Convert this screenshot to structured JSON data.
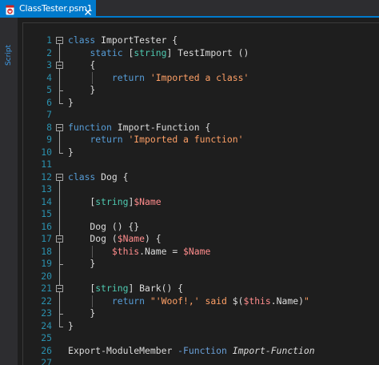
{
  "tab": {
    "title": "ClassTester.psm1",
    "icon": "powershell-file-icon",
    "close_icon": "close-icon"
  },
  "side": {
    "label": "Script"
  },
  "colors": {
    "accent": "#007acc",
    "keyword": "#569cd6",
    "type": "#4ec9b0",
    "variable": "#ff8c8c",
    "string": "#ffa066",
    "line_number": "#2b91af",
    "plain": "#dcdcdc"
  },
  "code": {
    "lines": [
      {
        "n": "1",
        "fold": "open",
        "tokens": [
          [
            "kw",
            "class"
          ],
          [
            "pr",
            " ImportTester {"
          ]
        ]
      },
      {
        "n": "2",
        "fold": "line",
        "tokens": [
          [
            "pr",
            "    "
          ],
          [
            "kw",
            "static"
          ],
          [
            "pr",
            " ["
          ],
          [
            "ty",
            "string"
          ],
          [
            "pr",
            "] TestImport ()"
          ]
        ]
      },
      {
        "n": "3",
        "fold": "open2",
        "tokens": [
          [
            "pr",
            "    {"
          ]
        ]
      },
      {
        "n": "4",
        "fold": "line",
        "tokens": [
          [
            "pr",
            "        "
          ],
          [
            "kw",
            "return"
          ],
          [
            "pr",
            " "
          ],
          [
            "st",
            "'Imported a class'"
          ]
        ]
      },
      {
        "n": "5",
        "fold": "end",
        "tokens": [
          [
            "pr",
            "    }"
          ]
        ]
      },
      {
        "n": "6",
        "fold": "end",
        "tokens": [
          [
            "pr",
            "}"
          ]
        ]
      },
      {
        "n": "7",
        "fold": "",
        "tokens": []
      },
      {
        "n": "8",
        "fold": "open",
        "tokens": [
          [
            "kw",
            "function"
          ],
          [
            "pr",
            " Import-Function {"
          ]
        ]
      },
      {
        "n": "9",
        "fold": "line",
        "tokens": [
          [
            "pr",
            "    "
          ],
          [
            "kw",
            "return"
          ],
          [
            "pr",
            " "
          ],
          [
            "st",
            "'Imported a function'"
          ]
        ]
      },
      {
        "n": "10",
        "fold": "end",
        "tokens": [
          [
            "pr",
            "}"
          ]
        ]
      },
      {
        "n": "11",
        "fold": "",
        "tokens": []
      },
      {
        "n": "12",
        "fold": "open",
        "tokens": [
          [
            "kw",
            "class"
          ],
          [
            "pr",
            " Dog {"
          ]
        ]
      },
      {
        "n": "13",
        "fold": "line",
        "tokens": []
      },
      {
        "n": "14",
        "fold": "line",
        "tokens": [
          [
            "pr",
            "    ["
          ],
          [
            "ty",
            "string"
          ],
          [
            "pr",
            "]"
          ],
          [
            "vr",
            "$Name"
          ]
        ]
      },
      {
        "n": "15",
        "fold": "line",
        "tokens": []
      },
      {
        "n": "16",
        "fold": "line",
        "tokens": [
          [
            "pr",
            "    Dog () {}"
          ]
        ]
      },
      {
        "n": "17",
        "fold": "open2",
        "tokens": [
          [
            "pr",
            "    Dog ("
          ],
          [
            "vr",
            "$Name"
          ],
          [
            "pr",
            ") {"
          ]
        ]
      },
      {
        "n": "18",
        "fold": "line",
        "tokens": [
          [
            "pr",
            "        "
          ],
          [
            "vr",
            "$this"
          ],
          [
            "pr",
            ".Name = "
          ],
          [
            "vr",
            "$Name"
          ]
        ]
      },
      {
        "n": "19",
        "fold": "end",
        "tokens": [
          [
            "pr",
            "    }"
          ]
        ]
      },
      {
        "n": "20",
        "fold": "line",
        "tokens": []
      },
      {
        "n": "21",
        "fold": "open2",
        "tokens": [
          [
            "pr",
            "    ["
          ],
          [
            "ty",
            "string"
          ],
          [
            "pr",
            "] Bark() {"
          ]
        ]
      },
      {
        "n": "22",
        "fold": "line",
        "tokens": [
          [
            "pr",
            "        "
          ],
          [
            "kw",
            "return"
          ],
          [
            "pr",
            " "
          ],
          [
            "st",
            "\"'Woof!,' said "
          ],
          [
            "pr",
            "$("
          ],
          [
            "vr",
            "$this"
          ],
          [
            "pr",
            ".Name)"
          ],
          [
            "st",
            "\""
          ]
        ]
      },
      {
        "n": "23",
        "fold": "end",
        "tokens": [
          [
            "pr",
            "    }"
          ]
        ]
      },
      {
        "n": "24",
        "fold": "end",
        "tokens": [
          [
            "pr",
            "}"
          ]
        ]
      },
      {
        "n": "25",
        "fold": "",
        "tokens": []
      },
      {
        "n": "26",
        "fold": "",
        "tokens": [
          [
            "pr",
            "Export-ModuleMember "
          ],
          [
            "par",
            "-Function"
          ],
          [
            "pr",
            " "
          ],
          [
            "itpr",
            "Import-Function"
          ]
        ]
      },
      {
        "n": "27",
        "fold": "",
        "tokens": []
      }
    ]
  }
}
